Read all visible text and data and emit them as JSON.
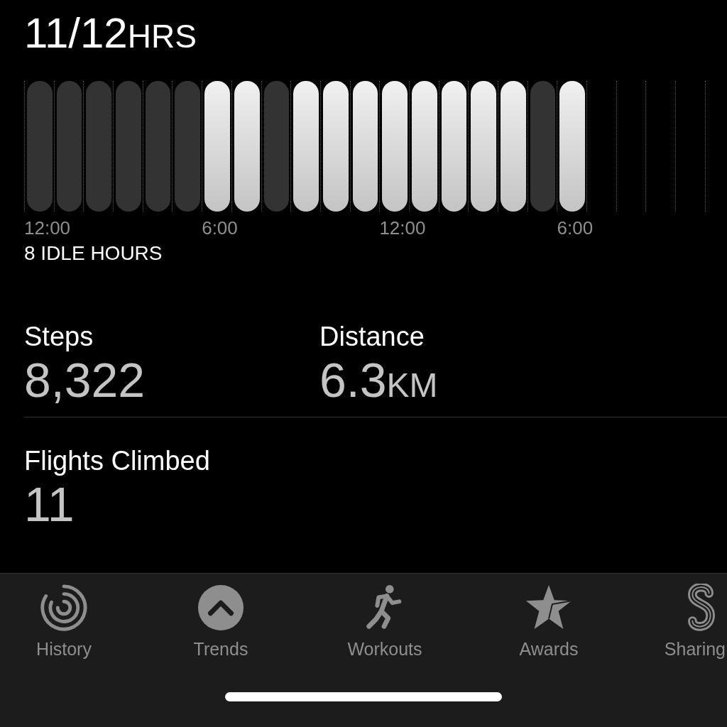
{
  "stand_hours": {
    "value": "11/12",
    "unit": "HRS"
  },
  "hours": [
    {
      "kind": "bar",
      "active": false
    },
    {
      "kind": "bar",
      "active": false
    },
    {
      "kind": "bar",
      "active": false
    },
    {
      "kind": "bar",
      "active": false
    },
    {
      "kind": "bar",
      "active": false
    },
    {
      "kind": "bar",
      "active": false
    },
    {
      "kind": "bar",
      "active": true
    },
    {
      "kind": "bar",
      "active": true
    },
    {
      "kind": "bar",
      "active": false
    },
    {
      "kind": "bar",
      "active": true
    },
    {
      "kind": "bar",
      "active": true
    },
    {
      "kind": "bar",
      "active": true
    },
    {
      "kind": "bar",
      "active": true
    },
    {
      "kind": "bar",
      "active": true
    },
    {
      "kind": "bar",
      "active": true
    },
    {
      "kind": "bar",
      "active": true
    },
    {
      "kind": "bar",
      "active": true
    },
    {
      "kind": "bar",
      "active": false
    },
    {
      "kind": "bar",
      "active": true
    },
    {
      "kind": "empty"
    },
    {
      "kind": "empty"
    },
    {
      "kind": "empty"
    },
    {
      "kind": "empty"
    },
    {
      "kind": "empty"
    }
  ],
  "axis_labels": [
    "12:00",
    "6:00",
    "12:00",
    "6:00"
  ],
  "idle_hours": "8 IDLE HOURS",
  "stats": [
    {
      "label": "Steps",
      "value": "8,322"
    },
    {
      "label": "Distance",
      "value": "6.3",
      "unit": "KM"
    },
    {
      "label": "Flights Climbed",
      "value": "11"
    }
  ],
  "tabs": [
    {
      "label": "History",
      "kind": "rings",
      "selected": false
    },
    {
      "label": "Trends",
      "kind": "trends",
      "selected": false
    },
    {
      "label": "Workouts",
      "kind": "runner",
      "selected": false
    },
    {
      "label": "Awards",
      "kind": "star",
      "selected": false
    },
    {
      "label": "Sharing",
      "kind": "sharing",
      "selected": false
    }
  ]
}
